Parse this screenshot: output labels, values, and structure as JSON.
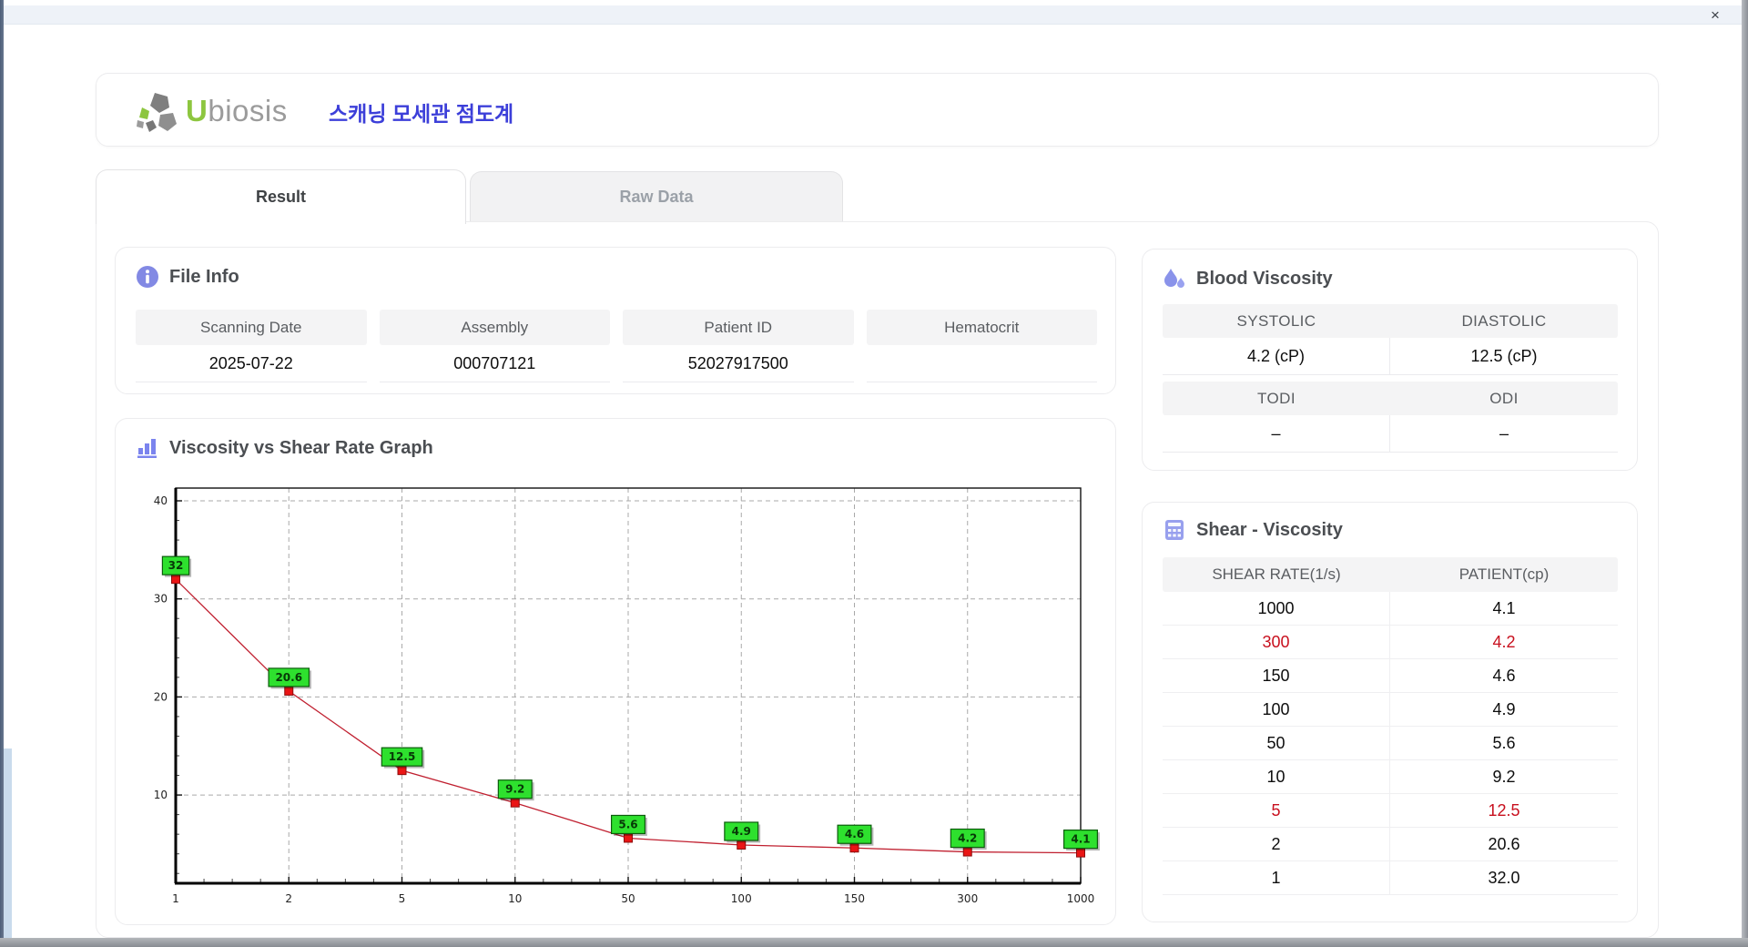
{
  "window": {
    "close_label": "×"
  },
  "header": {
    "logo_u": "U",
    "logo_rest": "biosis",
    "app_title_ko": "스캐닝 모세관 점도계"
  },
  "tabs": [
    {
      "label": "Result",
      "active": true
    },
    {
      "label": "Raw Data",
      "active": false
    }
  ],
  "file_info": {
    "title": "File Info",
    "fields": [
      {
        "label": "Scanning Date",
        "value": "2025-07-22"
      },
      {
        "label": "Assembly",
        "value": "000707121"
      },
      {
        "label": "Patient ID",
        "value": "52027917500"
      },
      {
        "label": "Hematocrit",
        "value": ""
      }
    ]
  },
  "blood_viscosity": {
    "title": "Blood Viscosity",
    "rows": [
      {
        "labels": [
          "SYSTOLIC",
          "DIASTOLIC"
        ],
        "values": [
          "4.2 (cP)",
          "12.5 (cP)"
        ]
      },
      {
        "labels": [
          "TODI",
          "ODI"
        ],
        "values": [
          "–",
          "–"
        ]
      }
    ]
  },
  "shear_viscosity": {
    "title": "Shear - Viscosity",
    "columns": [
      "SHEAR RATE(1/s)",
      "PATIENT(cp)"
    ],
    "highlight_color": "#c8101e",
    "rows": [
      {
        "shear_rate": "1000",
        "patient": "4.1",
        "highlight": false
      },
      {
        "shear_rate": "300",
        "patient": "4.2",
        "highlight": true
      },
      {
        "shear_rate": "150",
        "patient": "4.6",
        "highlight": false
      },
      {
        "shear_rate": "100",
        "patient": "4.9",
        "highlight": false
      },
      {
        "shear_rate": "50",
        "patient": "5.6",
        "highlight": false
      },
      {
        "shear_rate": "10",
        "patient": "9.2",
        "highlight": false
      },
      {
        "shear_rate": "5",
        "patient": "12.5",
        "highlight": true
      },
      {
        "shear_rate": "2",
        "patient": "20.6",
        "highlight": false
      },
      {
        "shear_rate": "1",
        "patient": "32.0",
        "highlight": false
      }
    ]
  },
  "graph_section": {
    "title": "Viscosity vs Shear Rate Graph"
  },
  "chart_data": {
    "type": "line",
    "title": "Viscosity vs Shear Rate Graph",
    "xlabel": "",
    "ylabel": "",
    "x_labels": [
      "1",
      "2",
      "5",
      "10",
      "50",
      "100",
      "150",
      "300",
      "1000"
    ],
    "values": [
      32,
      20.6,
      12.5,
      9.2,
      5.6,
      4.9,
      4.6,
      4.2,
      4.1
    ],
    "point_labels": [
      "32",
      "20.6",
      "12.5",
      "9.2",
      "5.6",
      "4.9",
      "4.6",
      "4.2",
      "4.1"
    ],
    "y_ticks": [
      10,
      20,
      30,
      40
    ],
    "ylim": [
      1,
      41.3
    ],
    "grid": true,
    "x_spacing": "equal steps per labeled shear rate",
    "legend": "none",
    "line_color": "#c02030",
    "marker_color": "#ea1515",
    "marker_edge_color": "#8d0d0d",
    "label_box_color": "#2ee02e",
    "label_box_edge": "#0c5c0c",
    "grid_color": "#a9a9a9"
  },
  "colors": {
    "accent_periwinkle": "#8289e4",
    "title_blue": "#3c3fd9",
    "logo_green": "#8dc63f",
    "highlight_red": "#c8101e"
  }
}
